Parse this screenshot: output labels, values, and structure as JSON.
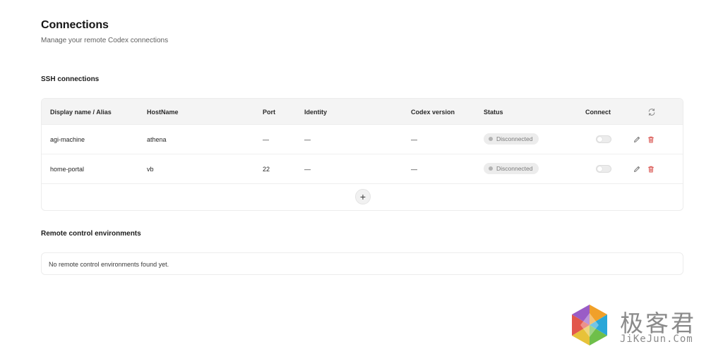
{
  "header": {
    "title": "Connections",
    "subtitle": "Manage your remote Codex connections"
  },
  "ssh": {
    "section_title": "SSH connections",
    "columns": [
      "Display name / Alias",
      "HostName",
      "Port",
      "Identity",
      "Codex version",
      "Status",
      "Connect"
    ],
    "rows": [
      {
        "name": "agi-machine",
        "host": "athena",
        "port": "—",
        "identity": "—",
        "codex_version": "—",
        "status": "Disconnected",
        "connected": false
      },
      {
        "name": "home-portal",
        "host": "vb",
        "port": "22",
        "identity": "—",
        "codex_version": "—",
        "status": "Disconnected",
        "connected": false
      }
    ],
    "add_label": "+"
  },
  "remote": {
    "section_title": "Remote control environments",
    "empty_text": "No remote control environments found yet."
  },
  "watermark": {
    "cn": "极客君",
    "en": "JiKeJun.Com"
  },
  "colors": {
    "badge_bg": "#ececec",
    "delete_icon": "#d9534f",
    "header_bg": "#f4f4f4"
  },
  "icons": {
    "refresh": "refresh-icon",
    "edit": "pencil-icon",
    "delete": "trash-icon",
    "add": "plus-icon"
  }
}
